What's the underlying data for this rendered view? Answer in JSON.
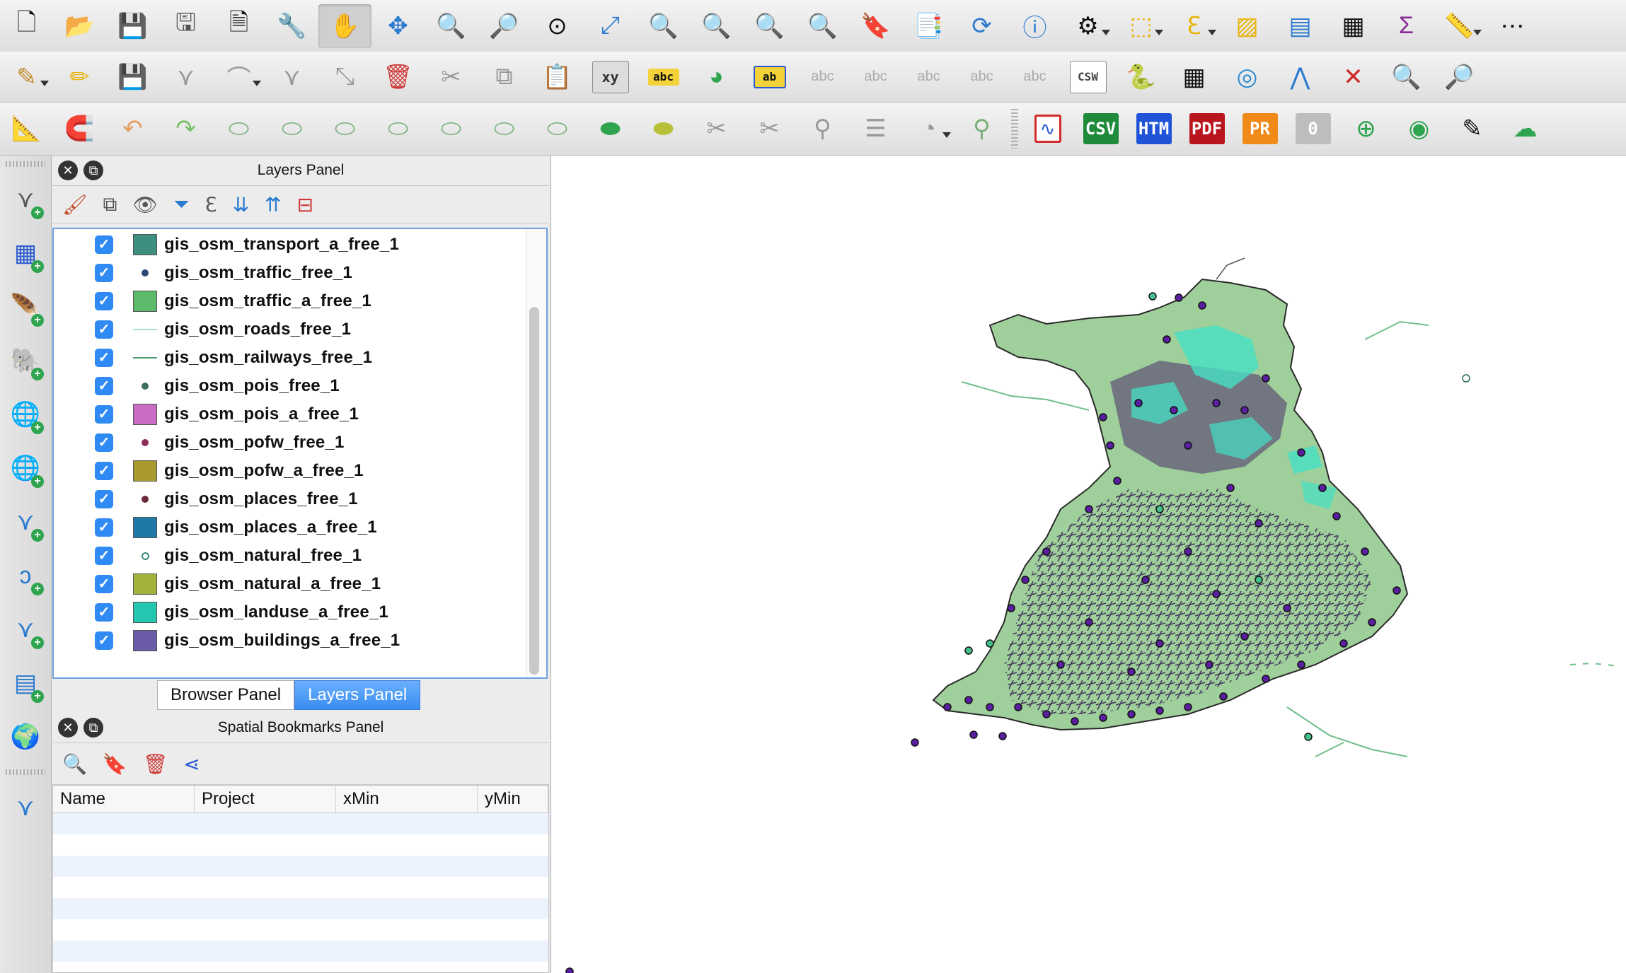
{
  "toolbar_row1": [
    "new-project-icon",
    "open-project-icon",
    "save-project-icon",
    "save-as-icon",
    "new-print-composer-icon",
    "composer-manager-icon",
    "pan-hand-icon",
    "pan-to-selection-icon",
    "zoom-in-icon",
    "zoom-out-icon",
    "zoom-native-icon",
    "zoom-full-icon",
    "zoom-to-selection-icon",
    "zoom-to-layer-icon",
    "zoom-last-icon",
    "zoom-next-icon",
    "new-bookmark-icon",
    "show-bookmarks-icon",
    "refresh-icon",
    "identify-icon",
    "action-icon",
    "select-features-icon",
    "select-expression-icon",
    "deselect-icon",
    "attribute-table-icon",
    "field-calculator-icon",
    "statistics-icon",
    "measure-icon"
  ],
  "toolbar_row3_badges": {
    "csv": "CSV",
    "htm": "HTM",
    "pdf": "PDF",
    "pr": "PR",
    "zero": "0"
  },
  "layers_panel": {
    "title": "Layers Panel",
    "layers": [
      {
        "name": "gis_osm_transport_a_free_1",
        "symbol": "fill",
        "color": "#3d8f7f"
      },
      {
        "name": "gis_osm_traffic_free_1",
        "symbol": "point",
        "color": "#2b4a73"
      },
      {
        "name": "gis_osm_traffic_a_free_1",
        "symbol": "fill",
        "color": "#5cbb6a"
      },
      {
        "name": "gis_osm_roads_free_1",
        "symbol": "line",
        "color": "#9fe0c8"
      },
      {
        "name": "gis_osm_railways_free_1",
        "symbol": "line",
        "color": "#4e9a72"
      },
      {
        "name": "gis_osm_pois_free_1",
        "symbol": "point",
        "color": "#3b6f5e"
      },
      {
        "name": "gis_osm_pois_a_free_1",
        "symbol": "fill",
        "color": "#c96bc3"
      },
      {
        "name": "gis_osm_pofw_free_1",
        "symbol": "point",
        "color": "#8b2f5a"
      },
      {
        "name": "gis_osm_pofw_a_free_1",
        "symbol": "fill",
        "color": "#a89a2c"
      },
      {
        "name": "gis_osm_places_free_1",
        "symbol": "point",
        "color": "#6a2a3a"
      },
      {
        "name": "gis_osm_places_a_free_1",
        "symbol": "fill",
        "color": "#1f78a8"
      },
      {
        "name": "gis_osm_natural_free_1",
        "symbol": "ring",
        "color": "#3a8b7c"
      },
      {
        "name": "gis_osm_natural_a_free_1",
        "symbol": "fill",
        "color": "#a3b23a"
      },
      {
        "name": "gis_osm_landuse_a_free_1",
        "symbol": "fill",
        "color": "#26c7b0"
      },
      {
        "name": "gis_osm_buildings_a_free_1",
        "symbol": "fill",
        "color": "#6a5aa8"
      }
    ]
  },
  "tabs": {
    "browser": "Browser Panel",
    "layers": "Layers Panel"
  },
  "bookmarks_panel": {
    "title": "Spatial Bookmarks Panel",
    "columns": [
      "Name",
      "Project",
      "xMin",
      "yMin"
    ]
  },
  "map_colors": {
    "land": "#9fcf9a",
    "urban": "#4a2d6e",
    "water_features": "#46e0c4",
    "points": "#5a1fa0"
  }
}
